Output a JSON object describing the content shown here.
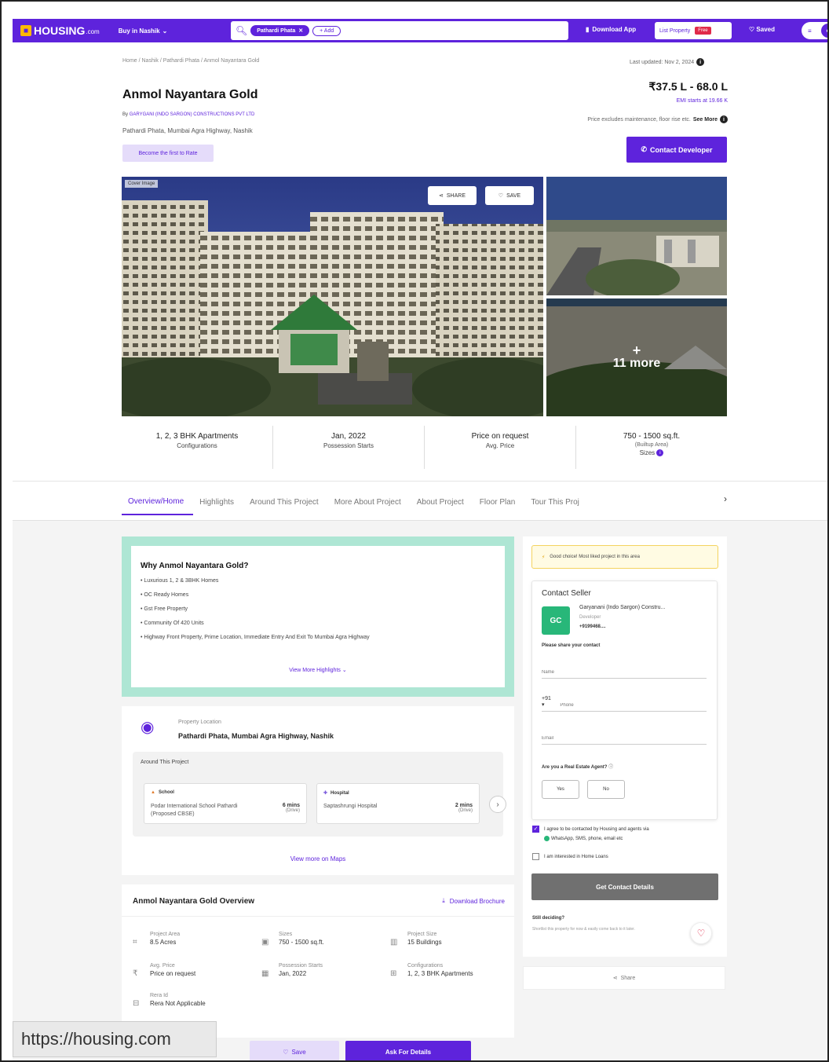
{
  "header": {
    "logo_text": "HOUSING",
    "logo_suffix": ".com",
    "buy_menu": "Buy in Nashik",
    "search_chip": "Pathardi Phata",
    "search_add": "+ Add",
    "download_app": "Download App",
    "list_property": "List Property",
    "free_badge": "Free",
    "saved": "Saved",
    "profile_icon": "avatar-icon"
  },
  "project": {
    "breadcrumb": "Home / Nashik / Pathardi Phata / Anmol Nayantara Gold",
    "last_updated": "Last updated: Nov 2, 2024",
    "title": "Anmol Nayantara Gold",
    "by": "By",
    "developer": "GARYGANI (INDO SARGON) CONSTRUCTIONS PVT LTD",
    "address": "Pathardi Phata, Mumbai Agra Highway, Nashik",
    "rate_badge": "Become the first to Rate",
    "price": "₹37.5 L - 68.0 L",
    "emi": "EMI starts at 19.66 K",
    "price_note": "Price excludes maintenance, floor rise etc.",
    "see_more": "See More",
    "contact_developer": "Contact Developer"
  },
  "gallery": {
    "cover_tag": "Cover Image",
    "share": "SHARE",
    "save": "SAVE",
    "more_count": "11 more"
  },
  "stats": [
    {
      "value": "1, 2, 3 BHK Apartments",
      "sub": "",
      "label": "Configurations"
    },
    {
      "value": "Jan, 2022",
      "sub": "",
      "label": "Possession Starts"
    },
    {
      "value": "Price on request",
      "sub": "",
      "label": "Avg. Price"
    },
    {
      "value": "750 - 1500 sq.ft.",
      "sub": "(Builtup Area)",
      "label": "Sizes"
    }
  ],
  "tabs": [
    "Overview/Home",
    "Highlights",
    "Around This Project",
    "More About Project",
    "About Project",
    "Floor Plan",
    "Tour This Proj"
  ],
  "why": {
    "title": "Why Anmol Nayantara Gold?",
    "points": [
      "Luxurious 1, 2 & 3BHK Homes",
      "OC Ready Homes",
      "Gst Free Property",
      "Community Of 420 Units",
      "Highway Front Property, Prime Location, Immediate Entry And Exit To Mumbai Agra Highway"
    ],
    "view_more": "View More Highlights"
  },
  "location": {
    "label": "Property Location",
    "value": "Pathardi Phata, Mumbai Agra Highway, Nashik",
    "around_title": "Around This Project",
    "pois": [
      {
        "category": "School",
        "name": "Podar International School Pathardi (Proposed CBSE)",
        "time": "6 mins",
        "mode": "(Drive)"
      },
      {
        "category": "Hospital",
        "name": "Saptashrungi Hospital",
        "time": "2 mins",
        "mode": "(Drive)"
      }
    ],
    "view_maps": "View more on Maps"
  },
  "overview": {
    "title": "Anmol Nayantara Gold Overview",
    "download": "Download Brochure",
    "items": [
      {
        "label": "Project Area",
        "value": "8.5 Acres"
      },
      {
        "label": "Sizes",
        "value": "750 - 1500 sq.ft."
      },
      {
        "label": "Project Size",
        "value": "15 Buildings"
      },
      {
        "label": "Avg. Price",
        "value": "Price on request"
      },
      {
        "label": "Possession Starts",
        "value": "Jan, 2022"
      },
      {
        "label": "Configurations",
        "value": "1, 2, 3 BHK Apartments"
      },
      {
        "label": "Rera Id",
        "value": "Rera Not Applicable"
      }
    ]
  },
  "bottom": {
    "save": "Save",
    "ask": "Ask For Details",
    "url_tip": "https://housing.com"
  },
  "sidebar": {
    "good_choice": "Good choice! Most liked project in this area",
    "contact_seller": "Contact Seller",
    "seller_initials": "GC",
    "seller_name": "Garyanani (Indo Sargon) Constru...",
    "seller_role": "Developer",
    "seller_phone": "+9199468....",
    "share_contact": "Please share your contact",
    "name_placeholder": "Name",
    "country_code": "+91",
    "phone_placeholder": "Phone",
    "email_placeholder": "Email",
    "agent_q": "Are you a Real Estate Agent?",
    "yes": "Yes",
    "no": "No",
    "agree_text": "I agree to be contacted by Housing and agents via",
    "agree_channels": "WhatsApp, SMS, phone, email etc",
    "home_loans": "I am interested in Home Loans",
    "get_contact": "Get Contact Details",
    "still_deciding": "Still deciding?",
    "still_sub": "Shortlist this property for now & easily come back to it later.",
    "share": "Share"
  },
  "colors": {
    "brand": "#5e23dc",
    "highlight": "#aee6d4",
    "whatsapp": "#28b779"
  }
}
